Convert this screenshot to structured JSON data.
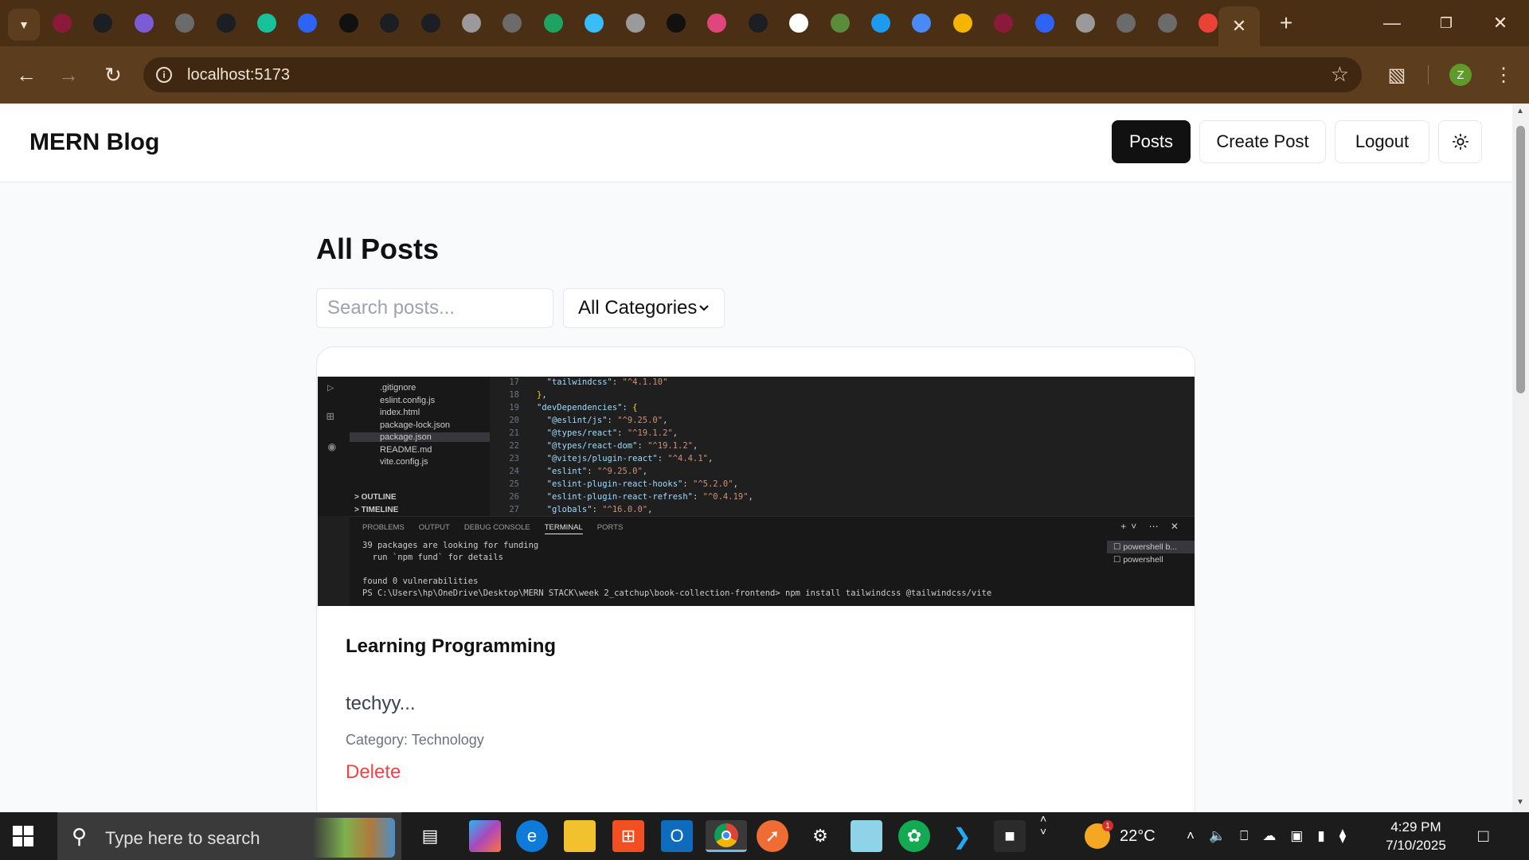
{
  "browser": {
    "tabs": [
      {
        "icon": "app-icon",
        "color": "#8b1a3a"
      },
      {
        "icon": "github-icon",
        "color": "#1b1f23"
      },
      {
        "icon": "octopus-icon",
        "color": "#7b5cd6"
      },
      {
        "icon": "globe-icon",
        "color": "#6b6b6b"
      },
      {
        "icon": "letter-c-icon",
        "color": "#1b1f23"
      },
      {
        "icon": "diamond-icon",
        "color": "#17c29b"
      },
      {
        "icon": "zoom-icon",
        "color": "#2d64f5"
      },
      {
        "icon": "pen-icon",
        "color": "#111111"
      },
      {
        "icon": "github-icon",
        "color": "#1b1f23"
      },
      {
        "icon": "github-icon",
        "color": "#1b1f23"
      },
      {
        "icon": "chrome-icon",
        "color": "#9a9a9a"
      },
      {
        "icon": "globe-icon",
        "color": "#6b6b6b"
      },
      {
        "icon": "meet-icon",
        "color": "#1ea362"
      },
      {
        "icon": "tailwind-icon",
        "color": "#38bdf8"
      },
      {
        "icon": "chrome-icon",
        "color": "#9a9a9a"
      },
      {
        "icon": "pen-icon",
        "color": "#111111"
      },
      {
        "icon": "shape-icon",
        "color": "#e0457b"
      },
      {
        "icon": "github-icon",
        "color": "#1b1f23"
      },
      {
        "icon": "openai-icon",
        "color": "#ffffff"
      },
      {
        "icon": "signal-icon",
        "color": "#5b8c3a"
      },
      {
        "icon": "x-icon",
        "color": "#1d9bf0"
      },
      {
        "icon": "sparkle-icon",
        "color": "#4a8af4"
      },
      {
        "icon": "drive-icon",
        "color": "#f4b400"
      },
      {
        "icon": "app-icon",
        "color": "#8b1a3a"
      },
      {
        "icon": "zoom-icon",
        "color": "#2d64f5"
      },
      {
        "icon": "chrome-icon",
        "color": "#9a9a9a"
      },
      {
        "icon": "globe-icon",
        "color": "#6b6b6b"
      },
      {
        "icon": "globe-icon",
        "color": "#6b6b6b"
      },
      {
        "icon": "gmail-icon",
        "color": "#ea4335"
      }
    ],
    "url": "localhost:5173",
    "profile_initial": "Z"
  },
  "navbar": {
    "brand": "MERN Blog",
    "posts_label": "Posts",
    "create_label": "Create Post",
    "logout_label": "Logout"
  },
  "page": {
    "title": "All Posts",
    "search_placeholder": "Search posts...",
    "category_selected": "All Categories"
  },
  "post": {
    "title": "Learning Programming",
    "excerpt": "techyy...",
    "category": "Category: Technology",
    "delete_label": "Delete",
    "image": {
      "files": [
        ".gitignore",
        "eslint.config.js",
        "index.html",
        "package-lock.json",
        "package.json",
        "README.md",
        "vite.config.js"
      ],
      "sections": [
        "OUTLINE",
        "TIMELINE"
      ],
      "line_numbers": [
        "17",
        "18",
        "19",
        "20",
        "21",
        "22",
        "23",
        "24",
        "25",
        "26",
        "27"
      ],
      "panel_tabs": [
        "PROBLEMS",
        "OUTPUT",
        "DEBUG CONSOLE",
        "TERMINAL",
        "PORTS"
      ],
      "terminal": [
        "39 packages are looking for funding",
        "  run `npm fund` for details",
        "",
        "found 0 vulnerabilities",
        "PS C:\\Users\\hp\\OneDrive\\Desktop\\MERN STACK\\week 2_catchup\\book-collection-frontend> npm install tailwindcss @tailwindcss/vite"
      ],
      "terminal_list": [
        "powershell b...",
        "powershell"
      ]
    }
  },
  "taskbar": {
    "search_placeholder": "Type here to search",
    "temperature": "22°C",
    "weather_badge": "1",
    "time": "4:29 PM",
    "date": "7/10/2025"
  }
}
